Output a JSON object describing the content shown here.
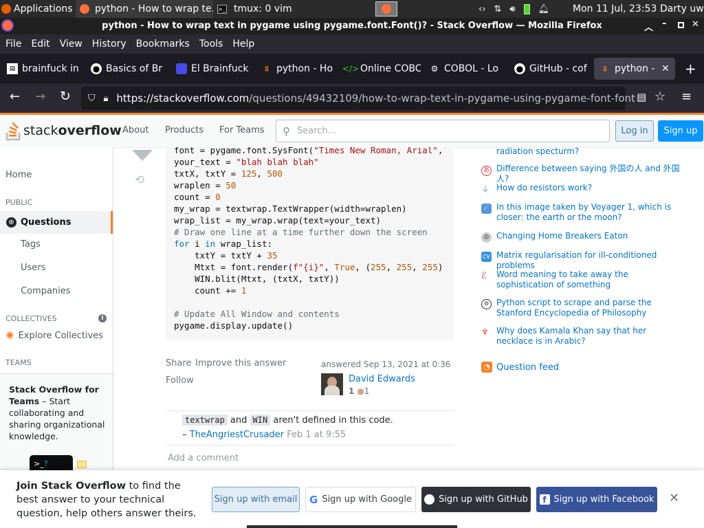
{
  "os_bar": {
    "applications": "Applications",
    "task1": "python - How to wrap te...",
    "task2": "tmux: 0 vim",
    "datetime": "Mon 11 Jul, 23:53",
    "user": "Darty uwu"
  },
  "window_title": "python - How to wrap text in pygame using pygame.font.Font()? - Stack Overflow — Mozilla Firefox",
  "menu": [
    "File",
    "Edit",
    "View",
    "History",
    "Bookmarks",
    "Tools",
    "Help"
  ],
  "tabs": [
    "brainfuck in",
    "Basics of Br",
    "El Brainfuck",
    "python - Ho",
    "Online COBC",
    "COBOL - Lo",
    "GitHub - cof",
    "python - "
  ],
  "url": {
    "host": "https://stackoverflow.com",
    "path": "/questions/49432109/how-to-wrap-text-in-pygame-using-pygame-font-font"
  },
  "so_header": {
    "logo_a": "stack",
    "logo_b": "overflow",
    "about": "About",
    "products": "Products",
    "for_teams": "For Teams",
    "search_placeholder": "Search…",
    "login": "Log in",
    "signup": "Sign up"
  },
  "left_nav": {
    "home": "Home",
    "public": "PUBLIC",
    "questions": "Questions",
    "tags": "Tags",
    "users": "Users",
    "companies": "Companies",
    "collectives": "COLLECTIVES",
    "explore": "Explore Collectives",
    "teams": "TEAMS",
    "teams_title": "Stack Overflow for Teams",
    "teams_text": " – Start collaborating and sharing organizational knowledge."
  },
  "code": {
    "l1a": "font = pygame.font.SysFont(",
    "l1b": "\"Times New Roman, Arial\"",
    "l1c": ",",
    "l2a": "your_text = ",
    "l2b": "\"blah blah blah\"",
    "l3a": "txtX, txtY = ",
    "l3b": "125",
    "l3c": ", ",
    "l3d": "500",
    "l4a": "wraplen = ",
    "l4b": "50",
    "l5a": "count = ",
    "l5b": "0",
    "l6": "my_wrap = textwrap.TextWrapper(width=wraplen)",
    "l7": "wrap_list = my_wrap.wrap(text=your_text)",
    "l8": "# Draw one line at a time further down the screen",
    "l9a": "for",
    "l9b": " i ",
    "l9c": "in",
    "l9d": " wrap_list:",
    "l10a": "    txtY = txtY + ",
    "l10b": "35",
    "l11a": "    Mtxt = font.render(",
    "l11b": "f\"{i}\"",
    "l11c": ", ",
    "l11d": "True",
    "l11e": ", (",
    "l11f": "255",
    "l11g": ", ",
    "l11h": "255",
    "l11i": ", ",
    "l11j": "255",
    "l11k": ")",
    "l12": "    WIN.blit(Mtxt, (txtX, txtY))",
    "l13a": "    count += ",
    "l13b": "1",
    "l15": "# Update All Window and contents",
    "l16": "pygame.display.update()"
  },
  "answer": {
    "share": "Share",
    "improve": "Improve this answer",
    "follow": "Follow",
    "answered": "answered Sep 13, 2021 at 0:36",
    "author": "David Edwards",
    "rep": "1",
    "bronze": "1"
  },
  "comment": {
    "code1": "textwrap",
    "and": " and ",
    "code2": "WIN",
    "rest": " aren't defined in this code.",
    "dash": "– ",
    "user": "TheAngriestCrusader",
    "date": "Feb 1 at 9:55",
    "add": "Add a comment"
  },
  "hot_questions": [
    {
      "title": "radiation specturm?"
    },
    {
      "title": "Difference between saying 外国の人 and 外国人?"
    },
    {
      "title": "How do resistors work?"
    },
    {
      "title": "In this image taken by Voyager 1, which is closer: the earth or the moon?"
    },
    {
      "title": "Changing Home Breakers Eaton"
    },
    {
      "title": "Matrix regularisation for ill-conditioned problems"
    },
    {
      "title": "Word meaning to take away the sophistication of something"
    },
    {
      "title": "Python script to scrape and parse the Stanford Encyclopedia of Philosophy"
    },
    {
      "title": "Why does Kamala Khan say that her necklace is in Arabic?"
    }
  ],
  "question_feed": "Question feed",
  "banner": {
    "bold": "Join Stack Overflow",
    "text": " to find the best answer to your technical question, help others answer theirs.",
    "email": "Sign up with email",
    "google": "Sign up with Google",
    "github": "Sign up with GitHub",
    "facebook": "Sign up with Facebook"
  }
}
